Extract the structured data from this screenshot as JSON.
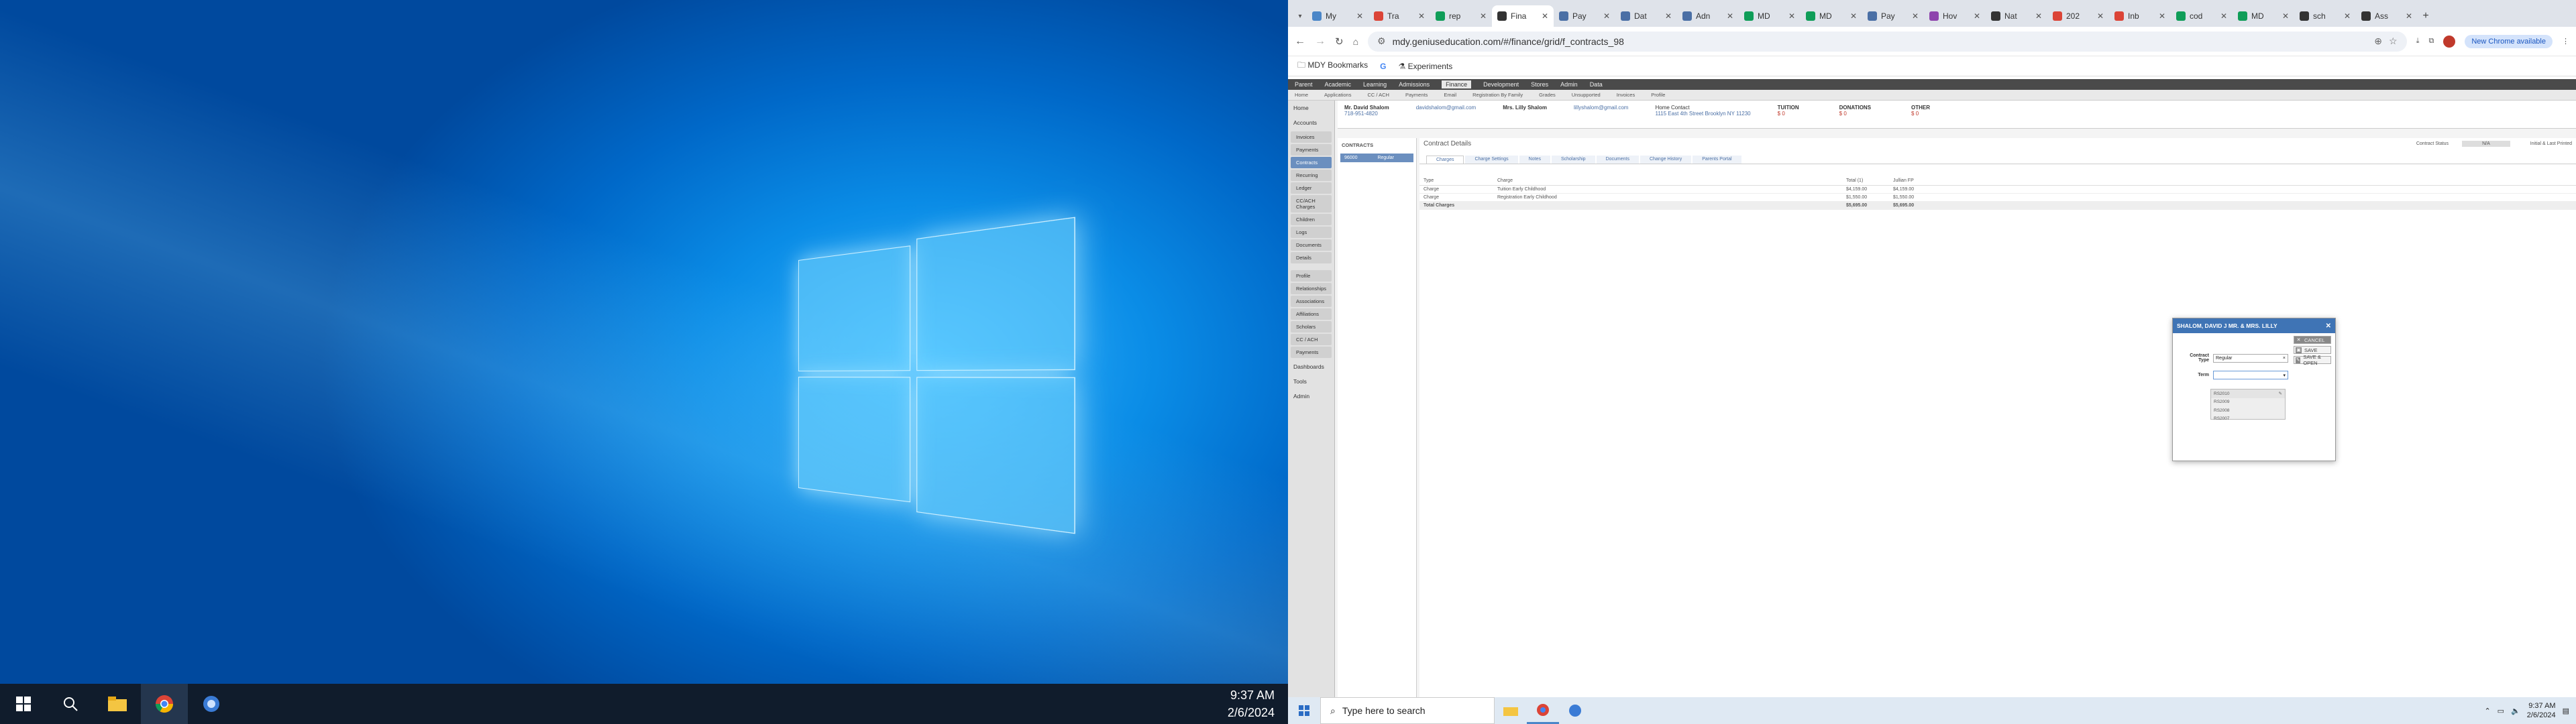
{
  "left_screen": {
    "clock_time": "9:37 AM",
    "clock_date": "2/6/2024"
  },
  "browser": {
    "tabs": [
      {
        "label": "My"
      },
      {
        "label": "Tra"
      },
      {
        "label": "rep"
      },
      {
        "label": "Fina",
        "active": true
      },
      {
        "label": "Pay"
      },
      {
        "label": "Dat"
      },
      {
        "label": "Adn"
      },
      {
        "label": "MD"
      },
      {
        "label": "MD"
      },
      {
        "label": "Pay"
      },
      {
        "label": "Hov"
      },
      {
        "label": "Nat"
      },
      {
        "label": "202"
      },
      {
        "label": "Inb"
      },
      {
        "label": "cod"
      },
      {
        "label": "MD"
      },
      {
        "label": "sch"
      },
      {
        "label": "Ass"
      }
    ],
    "url": "mdy.geniuseducation.com/#/finance/grid/f_contracts_98",
    "new_chrome_label": "New Chrome available",
    "bookmarks": [
      {
        "label": "MDY Bookmarks"
      },
      {
        "label": "G"
      },
      {
        "label": "Experiments"
      }
    ]
  },
  "app": {
    "nav": [
      "Parent",
      "Academic",
      "Learning",
      "Admissions",
      "Finance",
      "Development",
      "Stores",
      "Admin",
      "Data"
    ],
    "subnav": [
      "Home",
      "Applications",
      "CC / ACH",
      "Payments",
      "Email",
      "Registration By Family",
      "Grades",
      "Unsupported",
      "Invoices",
      "Profile"
    ],
    "sidebar": {
      "home": "Home",
      "accounts": "Accounts",
      "items": [
        "Invoices",
        "Payments",
        "Contracts",
        "Recurring",
        "Ledger",
        "CC/ACH Charges",
        "Children",
        "Logs",
        "Documents",
        "Details"
      ],
      "items2": [
        "Profile",
        "Relationships",
        "Associations",
        "Affiliations",
        "Scholars",
        "CC / ACH",
        "Payments"
      ],
      "dashboards": "Dashboards",
      "tools": "Tools",
      "admin": "Admin"
    },
    "family": {
      "parent1": "Mr. David Shalom",
      "parent1_phone": "718-951-4820",
      "parent1_email": "davidshalom@gmail.com",
      "parent2": "Mrs. Lilly Shalom",
      "parent2_email": "lillyshalom@gmail.com",
      "home_contact": "Home Contact",
      "address": "1115 East 4th Street Brooklyn NY 11230",
      "tuition": "TUITION",
      "donations": "DONATIONS",
      "other": "OTHER",
      "values": [
        "$ 0",
        "$ 0",
        "$ 0"
      ]
    },
    "contracts_panel_title": "CONTRACTS",
    "contracts_row": {
      "id": "96000",
      "type": "Regular"
    },
    "details_title": "Contract Details",
    "contract_status_label": "Contract Status",
    "contract_status_value": "N/A",
    "initial_last_printed": "Initial & Last Printed",
    "detail_tabs": [
      "Charges",
      "Charge Settings",
      "Notes",
      "Scholarship",
      "Documents",
      "Change History",
      "Parents Portal"
    ],
    "table_headers": [
      "Type",
      "Charge",
      "Total (1)",
      "Jullian FP"
    ],
    "table_rows": [
      {
        "type": "Charge",
        "charge": "Tuition Early Childhood",
        "total": "$4,159.00",
        "fp": "$4,159.00"
      },
      {
        "type": "Charge",
        "charge": "Registration Early Childhood",
        "total": "$1,550.00",
        "fp": "$1,550.00"
      },
      {
        "type": "Total Charges",
        "charge": "",
        "total": "$5,695.00",
        "fp": "$5,695.00"
      }
    ]
  },
  "modal": {
    "title": "SHALOM, DAVID J MR. & MRS. LILLY",
    "contract_type_label": "Contract Type",
    "contract_type_value": "Regular",
    "term_label": "Term",
    "term_value": "",
    "term_options": [
      "RS2010",
      "RS2009",
      "RS2008",
      "RS2007"
    ],
    "buttons": {
      "cancel": "CANCEL",
      "save": "SAVE",
      "save_open": "SAVE & OPEN"
    }
  },
  "right_taskbar": {
    "search_placeholder": "Type here to search",
    "time": "9:37 AM",
    "date": "2/6/2024"
  }
}
